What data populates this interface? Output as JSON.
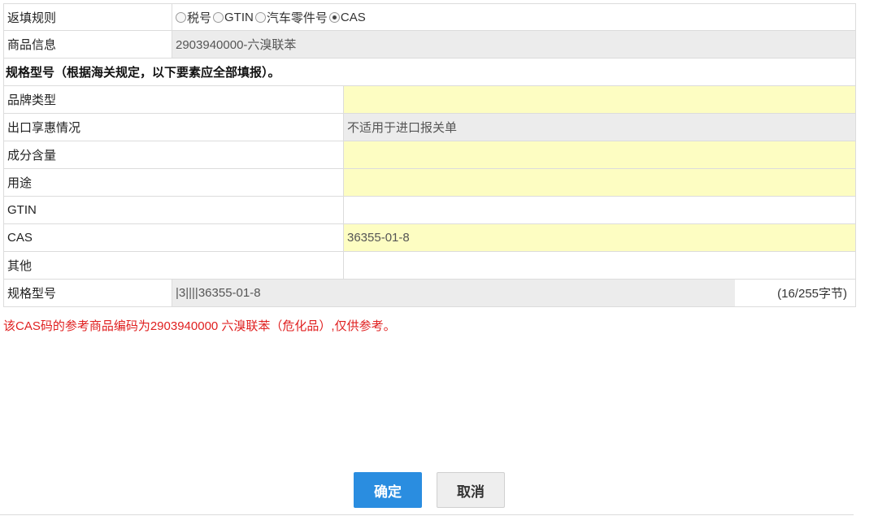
{
  "form": {
    "rule_label": "返填规则",
    "rule_options": [
      {
        "label": "税号",
        "selected": false
      },
      {
        "label": "GTIN",
        "selected": false
      },
      {
        "label": "汽车零件号",
        "selected": false
      },
      {
        "label": "CAS",
        "selected": true
      }
    ],
    "product_label": "商品信息",
    "product_value": "2903940000-六溴联苯",
    "spec_heading": "规格型号（根据海关规定，以下要素应全部填报）。",
    "fields": [
      {
        "label": "品牌类型",
        "value": ""
      },
      {
        "label": "出口享惠情况",
        "value": "不适用于进口报关单"
      },
      {
        "label": "成分含量",
        "value": ""
      },
      {
        "label": "用途",
        "value": ""
      },
      {
        "label": "GTIN",
        "value": ""
      },
      {
        "label": "CAS",
        "value": "36355-01-8"
      },
      {
        "label": "其他",
        "value": ""
      }
    ],
    "spec_label": "规格型号",
    "spec_value": "|3||||36355-01-8",
    "spec_count": "(16/255字节)",
    "warning": "该CAS码的参考商品编码为2903940000 六溴联苯（危化品）,仅供参考。"
  },
  "buttons": {
    "confirm": "确定",
    "cancel": "取消"
  },
  "colors": {
    "required_bg": "#fdfdc2",
    "readonly_bg": "#ececec",
    "primary": "#2a8de0",
    "warning": "#e02020"
  }
}
